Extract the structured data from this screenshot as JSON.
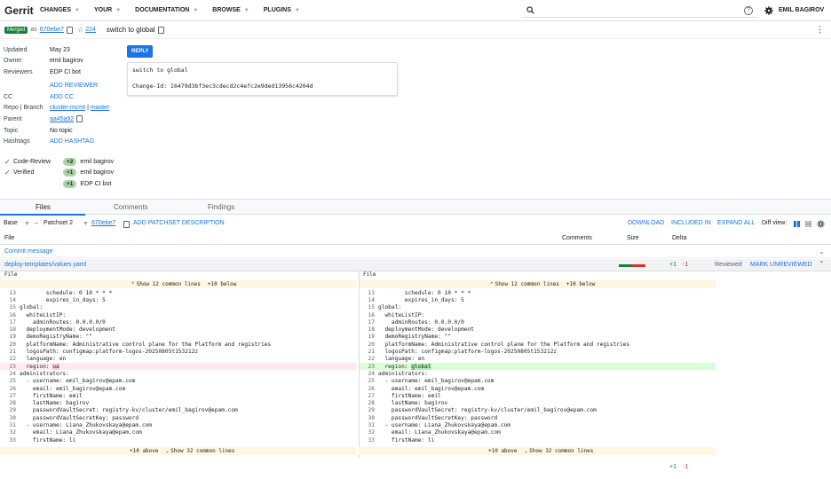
{
  "header": {
    "logo": "Gerrit",
    "nav": [
      "CHANGES",
      "YOUR",
      "DOCUMENTATION",
      "BROWSE",
      "PLUGINS"
    ],
    "username": "EMIL BAGIROV"
  },
  "change": {
    "status": "Merged",
    "as_text": "as",
    "commit": "670ebe7",
    "star_count": "224",
    "subject": "switch to global"
  },
  "meta": {
    "updated_label": "Updated",
    "updated": "May 23",
    "owner_label": "Owner",
    "owner": "emil bagirov",
    "reviewers_label": "Reviewers",
    "reviewers": "EDP CI bot",
    "add_reviewer": "ADD REVIEWER",
    "cc_label": "CC",
    "add_cc": "ADD CC",
    "repo_label": "Repo | Branch",
    "repo": "cluster-mcmt",
    "branch_sep": "|",
    "branch": "master",
    "parent_label": "Parent",
    "parent": "aa45a92",
    "topic_label": "Topic",
    "topic": "No topic",
    "hashtags_label": "Hashtags",
    "add_hashtag": "ADD HASHTAG"
  },
  "reply_label": "REPLY",
  "commit_message": {
    "line1": "switch to global",
    "line2": "Change-Id: I6479d3bf3ec3cdecd2c4efc2e9ded13956c4204d"
  },
  "labels": [
    {
      "name": "Code-Review",
      "vote": "+2",
      "by": "emil bagirov"
    },
    {
      "name": "Verified",
      "vote": "+1",
      "by": "emil bagirov"
    },
    {
      "name": "",
      "vote": "+1",
      "by": "EDP CI bot"
    }
  ],
  "tabs": [
    "Files",
    "Comments",
    "Findings"
  ],
  "filecontrols": {
    "base": "Base",
    "arrow": "→",
    "patchset": "Patchset 2",
    "commit": "670ebe7",
    "add_desc": "ADD PATCHSET DESCRIPTION",
    "download": "DOWNLOAD",
    "included_in": "INCLUDED IN",
    "expand_all": "EXPAND ALL",
    "diff_view": "Diff view:"
  },
  "filehead": {
    "file": "File",
    "comments": "Comments",
    "size": "Size",
    "delta": "Delta"
  },
  "commit_message_row": "Commit message",
  "file_row": {
    "path": "deploy-templates/values.yaml",
    "added": "+1",
    "removed": "-1",
    "reviewed": "Reviewed",
    "mark": "MARK UNREVIEWED"
  },
  "diff": {
    "left_head": "File",
    "right_head": "File",
    "top_context": "Show 12 common lines",
    "top_more": "+10 below",
    "bottom_more": "+10 above",
    "bottom_context": "Show 32 common lines",
    "lines": [
      {
        "n": "13",
        "t": "        schedule: 0 10 * * *"
      },
      {
        "n": "14",
        "t": "        expires_in_days: 5"
      },
      {
        "n": "15",
        "t": "global:"
      },
      {
        "n": "16",
        "t": "  whiteListIP:"
      },
      {
        "n": "17",
        "t": "    adminRoutes: 0.0.0.0/0"
      },
      {
        "n": "18",
        "t": "  deploymentMode: development"
      },
      {
        "n": "19",
        "t": "  demoRegistryName: \"\""
      },
      {
        "n": "20",
        "t": "  platformName: Administrative control plane for the Platform and registries"
      },
      {
        "n": "21",
        "t": "  logosPath: configmap:platform-logos-20250805t153212z"
      },
      {
        "n": "22",
        "t": "  language: en"
      },
      {
        "n": "23",
        "t": "  region: ",
        "changed": true
      },
      {
        "n": "24",
        "t": "administrators:"
      },
      {
        "n": "25",
        "t": "  - username: emil_bagirov@epam.com"
      },
      {
        "n": "26",
        "t": "    email: emil_bagirov@epam.com"
      },
      {
        "n": "27",
        "t": "    firstName: emil"
      },
      {
        "n": "28",
        "t": "    lastName: bagirov"
      },
      {
        "n": "29",
        "t": "    passwordVaultSecret: registry-kv/cluster/emil_bagirov@epam.com"
      },
      {
        "n": "30",
        "t": "    passwordVaultSecretKey: password"
      },
      {
        "n": "31",
        "t": "  - username: Liana_Zhukovskaya@epam.com"
      },
      {
        "n": "32",
        "t": "    email: Liana_Zhukovskaya@epam.com"
      },
      {
        "n": "33",
        "t": "    firstName: li"
      }
    ],
    "old_value": "ua",
    "new_value": "global"
  },
  "bottom": {
    "added": "+1",
    "removed": "-1"
  },
  "colors": {
    "accent": "#1a73e8",
    "merged": "#188038",
    "del": "#ffebee",
    "ins": "#d8fed8"
  }
}
